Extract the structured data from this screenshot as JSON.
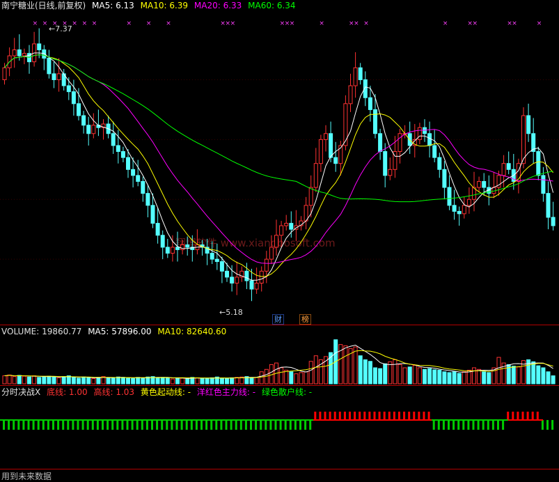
{
  "price_header": {
    "name": "南宁糖业(日线,前复权)",
    "ma5": "MA5: 6.13",
    "ma10": "MA10: 6.39",
    "ma20": "MA20: 6.33",
    "ma60": "MA60: 6.34"
  },
  "volume_header": {
    "volume": "VOLUME: 19860.77",
    "ma5": "MA5: 57896.00",
    "ma10": "MA10: 82640.60"
  },
  "indicator_header": {
    "name": "分时决战X",
    "bottom": "底线: 1.00",
    "top": "高线: 1.03",
    "yellow": "黄色起动线: -",
    "magenta": "洋红色主力线: -",
    "green": "绿色散户线: -"
  },
  "footer_text": "用到未来数据",
  "watermark": "翔博软件 www.xiangbosoft.com",
  "markers": {
    "cai": "财",
    "bang": "榜"
  },
  "annotations": {
    "high": "7.37",
    "low": "5.18"
  },
  "colors": {
    "up": "#ff3232",
    "down": "#54ffff",
    "ma5": "#ffffff",
    "ma10": "#ffff00",
    "ma20": "#ff00ff",
    "ma60": "#00ff00",
    "bar_green": "#00cc00",
    "bar_red": "#ff0000"
  },
  "chart_data": [
    {
      "type": "candlestick",
      "title": "南宁糖业(日线,前复权)",
      "series": [
        {
          "name": "MA5",
          "last": 6.13
        },
        {
          "name": "MA10",
          "last": 6.39
        },
        {
          "name": "MA20",
          "last": 6.33
        },
        {
          "name": "MA60",
          "last": 6.34
        }
      ],
      "high_label": 7.37,
      "low_label": 5.18,
      "ylim": [
        5.0,
        7.55
      ],
      "closes": [
        7.1,
        7.2,
        7.25,
        7.2,
        7.22,
        7.15,
        7.3,
        7.25,
        7.18,
        7.05,
        7.0,
        7.05,
        6.95,
        6.9,
        6.8,
        6.7,
        6.62,
        6.55,
        6.62,
        6.6,
        6.63,
        6.55,
        6.45,
        6.4,
        6.35,
        6.25,
        6.2,
        6.15,
        6.05,
        5.95,
        5.8,
        5.7,
        5.6,
        5.55,
        5.6,
        5.58,
        5.62,
        5.6,
        5.58,
        5.62,
        5.6,
        5.55,
        5.5,
        5.48,
        5.4,
        5.35,
        5.3,
        5.35,
        5.4,
        5.32,
        5.25,
        5.3,
        5.4,
        5.5,
        5.6,
        5.7,
        5.78,
        5.8,
        5.75,
        5.78,
        5.82,
        5.95,
        6.1,
        6.3,
        6.5,
        6.55,
        6.35,
        6.3,
        6.45,
        6.8,
        6.95,
        7.1,
        7.0,
        6.85,
        6.75,
        6.55,
        6.4,
        6.2,
        6.25,
        6.4,
        6.55,
        6.55,
        6.45,
        6.5,
        6.6,
        6.55,
        6.45,
        6.35,
        6.25,
        6.1,
        5.95,
        5.9,
        5.88,
        5.95,
        6.0,
        6.1,
        6.15,
        6.1,
        6.05,
        6.1,
        6.2,
        6.3,
        6.25,
        6.15,
        6.3,
        6.7,
        6.55,
        6.4,
        6.2,
        6.05,
        5.85,
        5.78
      ],
      "opens": [
        7.0,
        7.1,
        7.2,
        7.25,
        7.2,
        7.22,
        7.15,
        7.3,
        7.25,
        7.18,
        7.05,
        7.0,
        7.05,
        6.95,
        6.9,
        6.8,
        6.7,
        6.62,
        6.55,
        6.62,
        6.6,
        6.63,
        6.55,
        6.45,
        6.4,
        6.35,
        6.25,
        6.2,
        6.15,
        6.05,
        5.95,
        5.8,
        5.7,
        5.6,
        5.55,
        5.6,
        5.58,
        5.62,
        5.6,
        5.58,
        5.62,
        5.6,
        5.55,
        5.5,
        5.48,
        5.4,
        5.35,
        5.3,
        5.35,
        5.4,
        5.32,
        5.25,
        5.3,
        5.4,
        5.5,
        5.6,
        5.7,
        5.78,
        5.8,
        5.75,
        5.78,
        5.82,
        5.95,
        6.1,
        6.3,
        6.5,
        6.55,
        6.35,
        6.3,
        6.45,
        6.8,
        6.95,
        7.1,
        7.0,
        6.85,
        6.75,
        6.55,
        6.4,
        6.2,
        6.25,
        6.4,
        6.55,
        6.55,
        6.45,
        6.5,
        6.6,
        6.55,
        6.45,
        6.35,
        6.25,
        6.1,
        5.95,
        5.9,
        5.88,
        5.95,
        6.0,
        6.1,
        6.15,
        6.1,
        6.05,
        6.1,
        6.2,
        6.3,
        6.25,
        6.15,
        6.3,
        6.7,
        6.55,
        6.4,
        6.2,
        6.05,
        5.85
      ]
    },
    {
      "type": "bar",
      "title": "VOLUME",
      "series": [
        {
          "name": "VOLUME",
          "last": 19860.77
        },
        {
          "name": "MA5",
          "last": 57896.0
        },
        {
          "name": "MA10",
          "last": 82640.6
        }
      ],
      "ylim": [
        0,
        120000
      ],
      "values": [
        20000,
        22000,
        18000,
        21000,
        19000,
        17000,
        20000,
        16000,
        18000,
        19000,
        17000,
        15000,
        18000,
        20000,
        16000,
        14000,
        17000,
        15000,
        13000,
        16000,
        18000,
        15000,
        14000,
        17000,
        16000,
        15000,
        13000,
        16000,
        14000,
        17000,
        18000,
        15000,
        16000,
        14000,
        12000,
        15000,
        14000,
        13000,
        16000,
        15000,
        14000,
        13000,
        15000,
        17000,
        14000,
        13000,
        15000,
        16000,
        17000,
        18000,
        15000,
        16000,
        30000,
        36000,
        48000,
        52000,
        40000,
        34000,
        30000,
        25000,
        28000,
        30000,
        56000,
        70000,
        60000,
        68000,
        78000,
        110000,
        98000,
        95000,
        88000,
        92000,
        70000,
        60000,
        56000,
        40000,
        38000,
        50000,
        55000,
        60000,
        48000,
        40000,
        42000,
        46000,
        40000,
        36000,
        38000,
        35000,
        34000,
        30000,
        28000,
        30000,
        26000,
        30000,
        34000,
        40000,
        36000,
        30000,
        28000,
        40000,
        66000,
        52000,
        48000,
        44000,
        42000,
        58000,
        60000,
        55000,
        45000,
        40000,
        30000,
        20000
      ]
    },
    {
      "type": "bar",
      "title": "分时决战X",
      "series": [
        {
          "name": "底线",
          "last": 1.0
        },
        {
          "name": "高线",
          "last": 1.03
        }
      ],
      "ylim": [
        0.97,
        1.06
      ]
    }
  ]
}
